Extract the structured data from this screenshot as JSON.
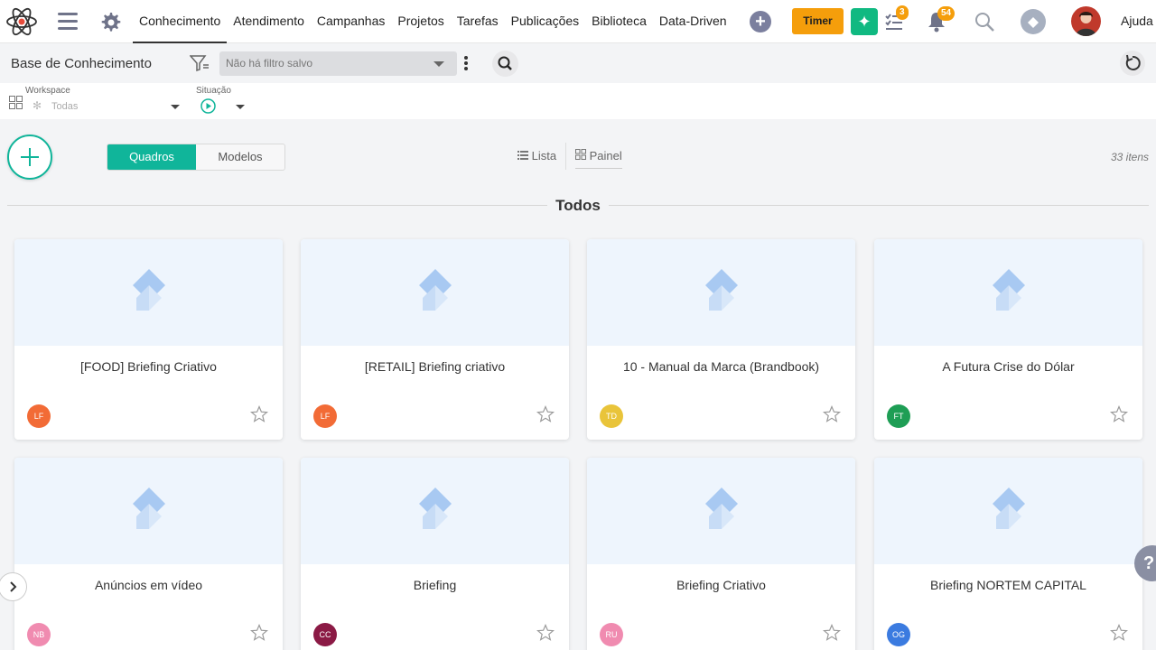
{
  "nav": {
    "tabs": [
      "Conhecimento",
      "Atendimento",
      "Campanhas",
      "Projetos",
      "Tarefas",
      "Publicações",
      "Biblioteca",
      "Data-Driven"
    ],
    "timer_label": "Timer",
    "tasks_badge": "3",
    "notifications_badge": "54",
    "help_label": "Ajuda"
  },
  "subbar": {
    "title": "Base de Conhecimento",
    "filter_placeholder": "Não há filtro salvo"
  },
  "filters": {
    "workspace_label": "Workspace",
    "workspace_value": "Todas",
    "situacao_label": "Situação"
  },
  "toolbar": {
    "seg_quadros": "Quadros",
    "seg_modelos": "Modelos",
    "view_lista": "Lista",
    "view_painel": "Painel",
    "count": "33 itens"
  },
  "section": {
    "title": "Todos"
  },
  "cards": [
    {
      "title": "[FOOD] Briefing Criativo",
      "initials": "LF",
      "color": "#f26b36"
    },
    {
      "title": "[RETAIL] Briefing criativo",
      "initials": "LF",
      "color": "#f26b36"
    },
    {
      "title": "10 - Manual da Marca (Brandbook)",
      "initials": "TD",
      "color": "#e9c43a"
    },
    {
      "title": "A Futura Crise do Dólar",
      "initials": "FT",
      "color": "#1e9e55"
    },
    {
      "title": "Anúncios em vídeo",
      "initials": "NB",
      "color": "#f08bb0"
    },
    {
      "title": "Briefing",
      "initials": "CC",
      "color": "#8b1a45"
    },
    {
      "title": "Briefing Criativo",
      "initials": "RU",
      "color": "#f08bb0"
    },
    {
      "title": "Briefing NORTEM CAPITAL",
      "initials": "OG",
      "color": "#3b7be0"
    }
  ]
}
